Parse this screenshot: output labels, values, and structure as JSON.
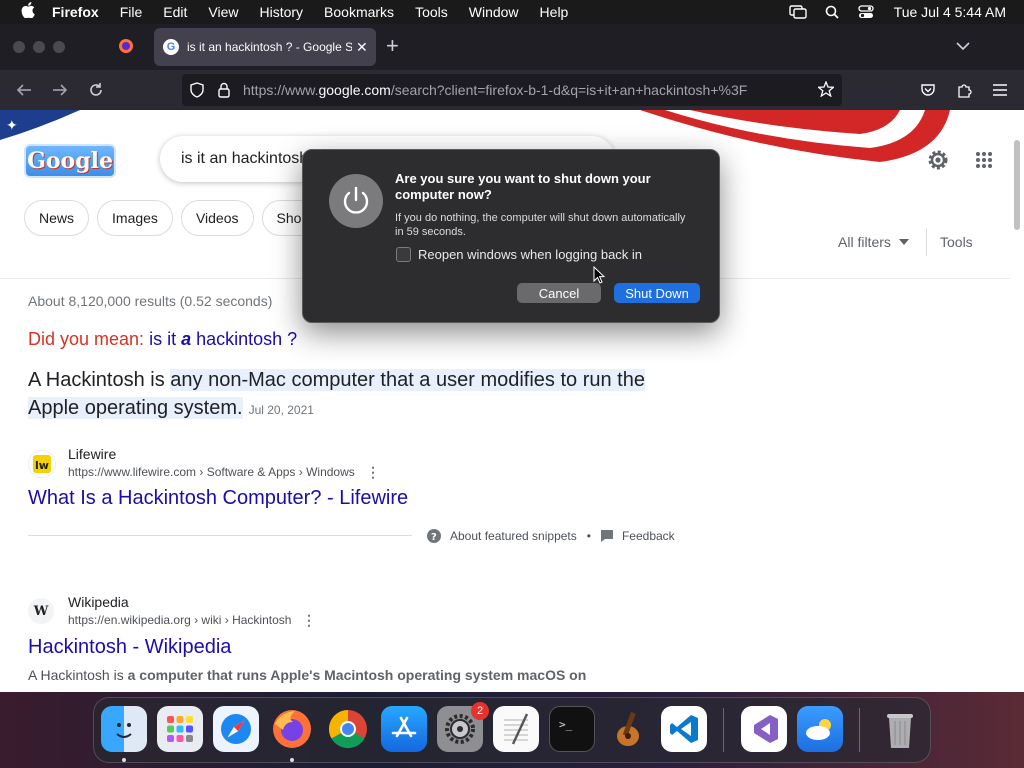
{
  "menubar": {
    "app_name": "Firefox",
    "items": [
      "File",
      "Edit",
      "View",
      "History",
      "Bookmarks",
      "Tools",
      "Window",
      "Help"
    ],
    "clock": "Tue Jul 4  5:44 AM"
  },
  "browser": {
    "tab_title": "is it an hackintosh ? - Google Se",
    "url_prefix": "https://www.",
    "url_domain": "google.com",
    "url_rest": "/search?client=firefox-b-1-d&q=is+it+an+hackintosh+%3F"
  },
  "google": {
    "logo_text": "Google",
    "query": "is it an hackintosh",
    "chips": [
      "News",
      "Images",
      "Videos",
      "Shop"
    ],
    "all_filters": "All filters",
    "tools": "Tools",
    "stats": "About 8,120,000 results (0.52 seconds)",
    "did_you_mean_label": "Did you mean:",
    "did_you_mean_pre": "is it ",
    "did_you_mean_bold": "a",
    "did_you_mean_post": " hackintosh ?",
    "answer_prefix": "A Hackintosh is ",
    "answer_highlight": "any non-Mac computer that a user modifies to run the Apple operating system.",
    "answer_date": "Jul 20, 2021",
    "about_snippets": "About featured snippets",
    "bullet": "•",
    "feedback": "Feedback",
    "results": [
      {
        "source": "Lifewire",
        "url": "https://www.lifewire.com › Software & Apps › Windows",
        "title": "What Is a Hackintosh Computer? - Lifewire",
        "icon_letter": "lw"
      },
      {
        "source": "Wikipedia",
        "url": "https://en.wikipedia.org › wiki › Hackintosh",
        "title": "Hackintosh - Wikipedia",
        "icon_letter": "W"
      }
    ],
    "desc_1": "A Hackintosh is ",
    "desc_2": "a computer that runs Apple's Macintosh operating system macOS on computer hardware not authorized for the purpose by Apple",
    "desc_3": "."
  },
  "dialog": {
    "title": "Are you sure you want to shut down your computer now?",
    "message": "If you do nothing, the computer will shut down automatically in 59 seconds.",
    "checkbox_label": "Reopen windows when logging back in",
    "checkbox_checked": false,
    "cancel": "Cancel",
    "confirm": "Shut Down"
  },
  "dock": {
    "apps": [
      "finder",
      "launchpad",
      "safari",
      "firefox",
      "chrome",
      "app-store",
      "system-settings",
      "textedit",
      "terminal",
      "garageband",
      "vscode",
      "visual-studio",
      "weather",
      "trash"
    ],
    "system_settings_badge": "2"
  },
  "colors": {
    "link": "#1a0dab",
    "dialog_primary": "#1f6fde",
    "did_you_mean": "#d93025"
  }
}
